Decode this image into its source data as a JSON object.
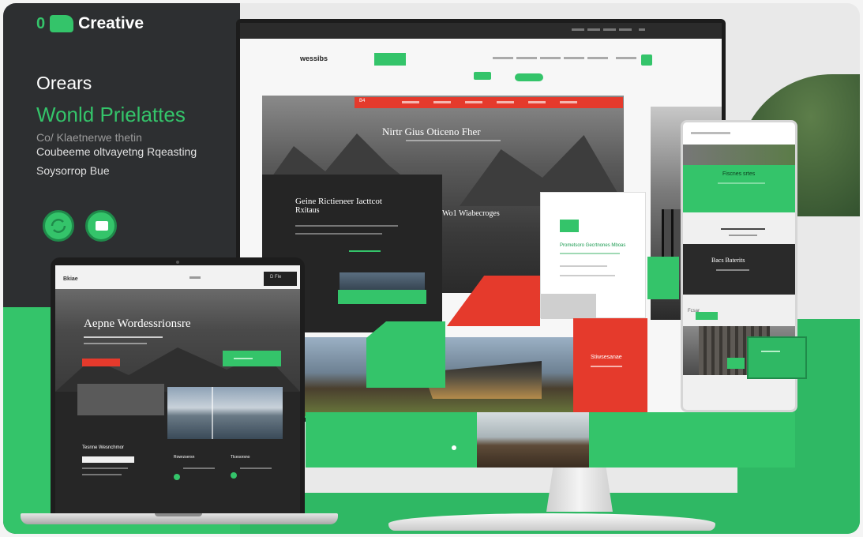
{
  "brand": {
    "prefix": "0",
    "name": "Creative"
  },
  "left_panel": {
    "title": "Orears",
    "subtitle": "Wonld Prielattes",
    "line1": "Co/ Klaetnerwe thetin",
    "line2": "Coubeeme oltvayetng   Rqeasting",
    "line3": "Soysorrop Bue"
  },
  "icons": [
    "refresh-icon",
    "monitor-icon"
  ],
  "monitor": {
    "nav_logo": "wessibs",
    "red_label": "B4",
    "hero_title": "Nirtr Gius Oticeno Fher",
    "card_title": "Geine Rictieneer Iacttcot",
    "card_subtitle": "Rxitaus",
    "mid_label": "Wo1 Wiabecroges",
    "white_card_title": "Prometsoro Gecrtnones Mboas",
    "red_block_title": "Stiwsesanae"
  },
  "phone": {
    "green_title": "Fiscnes srtes",
    "dark_title": "Bacs Baterits",
    "small_label": "Fcsar"
  },
  "laptop": {
    "nav_logo": "Bkiae",
    "nav_button": "D Fle",
    "hero_title": "Aepne Wordessrionsre",
    "section_title": "Tesnne Wesnchmor",
    "col1": "Rowrzsersn",
    "col2": "Tlcesorsno"
  },
  "colors": {
    "accent": "#34c46a",
    "red": "#e53a2c",
    "dark": "#2d2f31"
  }
}
